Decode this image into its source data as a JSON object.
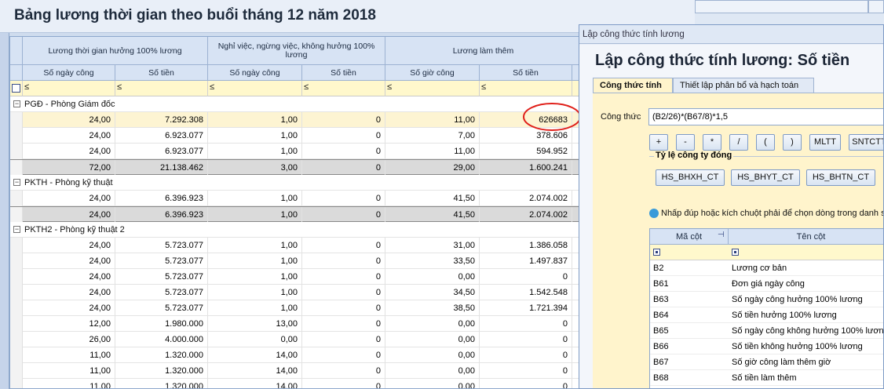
{
  "window": {
    "title": "Bảng lương thời gian theo buổi tháng 12 năm 2018"
  },
  "grid": {
    "headers_top": [
      "Lương thời gian hưởng 100% lương",
      "Nghỉ việc, ngừng việc, không hưởng 100% lương",
      "Lương làm thêm"
    ],
    "headers_sub": [
      "Số ngày công",
      "Số tiền",
      "Số ngày công",
      "Số tiền",
      "Số giờ công",
      "Số tiền"
    ],
    "filter_symbol": "≤",
    "groups": [
      {
        "label": "PGĐ - Phòng Giám đốc",
        "rows": [
          [
            "24,00",
            "7.292.308",
            "1,00",
            "0",
            "11,00",
            "626683"
          ],
          [
            "24,00",
            "6.923.077",
            "1,00",
            "0",
            "7,00",
            "378.606"
          ],
          [
            "24,00",
            "6.923.077",
            "1,00",
            "0",
            "11,00",
            "594.952"
          ]
        ],
        "summary": [
          "72,00",
          "21.138.462",
          "3,00",
          "0",
          "29,00",
          "1.600.241"
        ]
      },
      {
        "label": "PKTH - Phòng kỹ thuật",
        "rows": [
          [
            "24,00",
            "6.396.923",
            "1,00",
            "0",
            "41,50",
            "2.074.002"
          ]
        ],
        "summary": [
          "24,00",
          "6.396.923",
          "1,00",
          "0",
          "41,50",
          "2.074.002"
        ]
      },
      {
        "label": "PKTH2 - Phòng kỹ thuật 2",
        "rows": [
          [
            "24,00",
            "5.723.077",
            "1,00",
            "0",
            "31,00",
            "1.386.058"
          ],
          [
            "24,00",
            "5.723.077",
            "1,00",
            "0",
            "33,50",
            "1.497.837"
          ],
          [
            "24,00",
            "5.723.077",
            "1,00",
            "0",
            "0,00",
            "0"
          ],
          [
            "24,00",
            "5.723.077",
            "1,00",
            "0",
            "34,50",
            "1.542.548"
          ],
          [
            "24,00",
            "5.723.077",
            "1,00",
            "0",
            "38,50",
            "1.721.394"
          ],
          [
            "12,00",
            "1.980.000",
            "13,00",
            "0",
            "0,00",
            "0"
          ],
          [
            "26,00",
            "4.000.000",
            "0,00",
            "0",
            "0,00",
            "0"
          ],
          [
            "11,00",
            "1.320.000",
            "14,00",
            "0",
            "0,00",
            "0"
          ],
          [
            "11,00",
            "1.320.000",
            "14,00",
            "0",
            "0,00",
            "0"
          ],
          [
            "11,00",
            "1.320.000",
            "14,00",
            "0",
            "0,00",
            "0"
          ]
        ]
      }
    ]
  },
  "dialog": {
    "caption": "Lập công thức tính lương",
    "heading": "Lập công thức tính lương: Số tiền",
    "tabs": [
      "Công thức tính",
      "Thiết lập phân bổ và hạch toán"
    ],
    "formula_label": "Công thức",
    "formula_value": "(B2/26)*(B67/8)*1,5",
    "operator_buttons": [
      "+",
      "-",
      "*",
      "/",
      "(",
      ")",
      "MLTT",
      "SNTCTT"
    ],
    "company_rate_title": "Tỷ lệ công ty đóng",
    "company_rate_buttons": [
      "HS_BHXH_CT",
      "HS_BHYT_CT",
      "HS_BHTN_CT"
    ],
    "hint": "Nhấp đúp hoặc kích chuột phải để chọn dòng trong danh s",
    "columns_table": {
      "headers": [
        "Mã cột",
        "Tên cột"
      ],
      "rows": [
        [
          "B2",
          "Lương cơ bản"
        ],
        [
          "B61",
          "Đơn giá ngày công"
        ],
        [
          "B63",
          "Số ngày công hưởng 100% lương"
        ],
        [
          "B64",
          "Số tiền hưởng 100% lương"
        ],
        [
          "B65",
          "Số ngày công không hưởng 100% lương"
        ],
        [
          "B66",
          "Số tiền không hưởng 100% lương"
        ],
        [
          "B67",
          "Số giờ công làm thêm giờ"
        ],
        [
          "B68",
          "Số tiền làm thêm"
        ]
      ]
    }
  },
  "colors": {
    "accent": "#d7e3f4",
    "selected_row": "#fdf4d2",
    "annotation": "#e0201a"
  }
}
